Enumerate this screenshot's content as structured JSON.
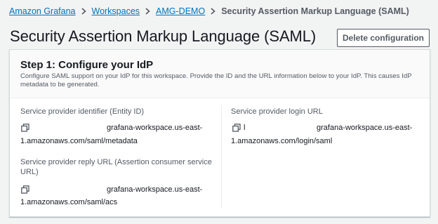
{
  "breadcrumb": {
    "items": [
      "Amazon Grafana",
      "Workspaces",
      "AMG-DEMO"
    ],
    "current": "Security Assertion Markup Language (SAML)"
  },
  "page": {
    "title": "Security Assertion Markup Language (SAML)",
    "delete_button_label": "Delete configuration"
  },
  "step": {
    "title": "Step 1: Configure your IdP",
    "description": "Configure SAML support on your IdP for this workspace. Provide the ID and the URL information below to your IdP. This causes IdP metadata to be generated."
  },
  "fields": {
    "entity_id": {
      "label": "Service provider identifier (Entity ID)",
      "value_line1": "grafana-workspace.us-east-",
      "value_line2": "1.amazonaws.com/saml/metadata"
    },
    "reply_url": {
      "label_line1": "Service provider reply URL (Assertion consumer service",
      "label_line2": "URL)",
      "value_line1": "grafana-workspace.us-east-",
      "value_line2": "1.amazonaws.com/saml/acs"
    },
    "login_url": {
      "label": "Service provider login URL",
      "value_prefix": "l",
      "value_line1": "grafana-workspace.us-east-",
      "value_line2": "1.amazonaws.com/login/saml"
    }
  },
  "colors": {
    "link": "#0073bb",
    "text": "#16191f",
    "secondary_text": "#545b64",
    "background": "#f2f3f3"
  },
  "icons": {
    "separator": "chevron-right-icon",
    "copy": "copy-icon"
  }
}
